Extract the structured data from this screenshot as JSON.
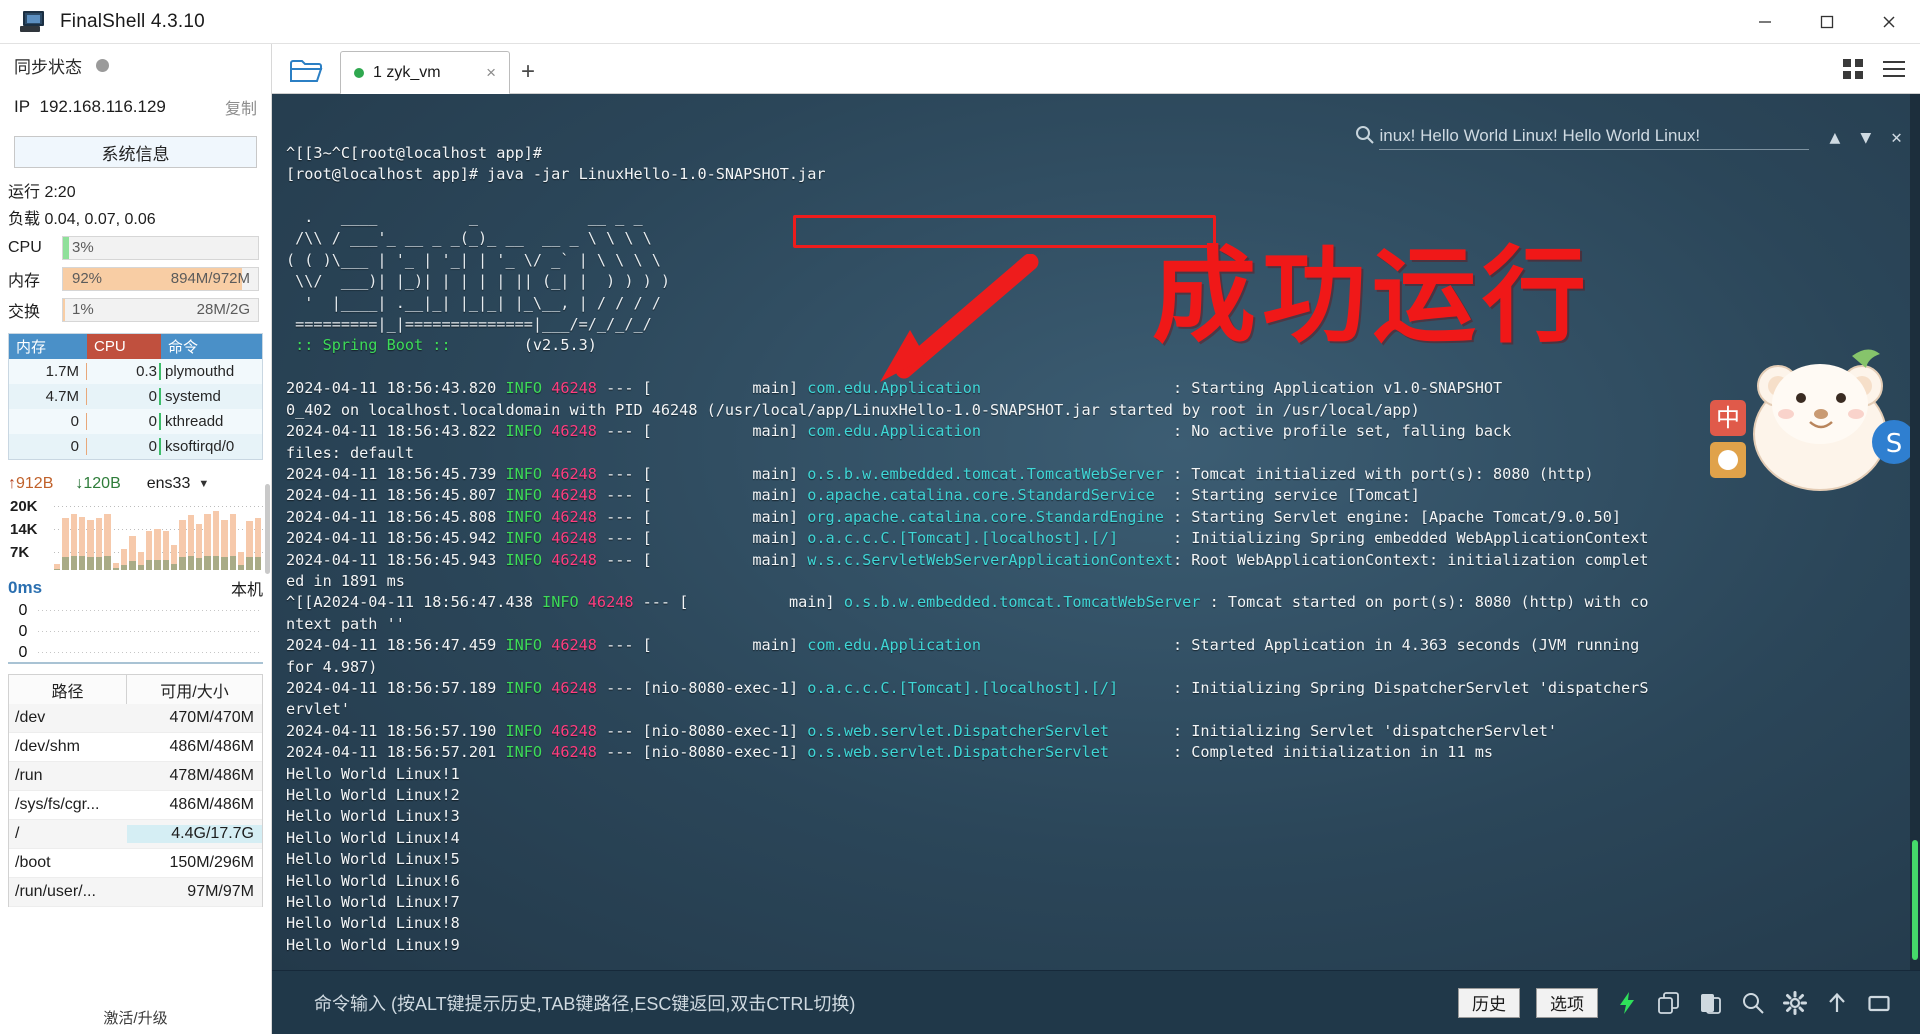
{
  "window": {
    "title": "FinalShell 4.3.10",
    "app_icon": "computer-icon",
    "minimize": "minimize-icon",
    "maximize": "maximize-icon",
    "close": "close-icon"
  },
  "sidebar": {
    "sync_label": "同步状态",
    "ip_label": "IP",
    "ip_value": "192.168.116.129",
    "copy_label": "复制",
    "sysinfo_button": "系统信息",
    "uptime": "运行 2:20",
    "load": "负载 0.04, 0.07, 0.06",
    "meters": [
      {
        "label": "CPU",
        "pct": "3%",
        "value": "",
        "fill": 3,
        "color": "#8fe09a"
      },
      {
        "label": "内存",
        "pct": "92%",
        "value": "894M/972M",
        "fill": 92,
        "color": "#f8cda4"
      },
      {
        "label": "交换",
        "pct": "1%",
        "value": "28M/2G",
        "fill": 1,
        "color": "#f8cda4"
      }
    ],
    "proc_headers": [
      "内存",
      "CPU",
      "命令"
    ],
    "processes": [
      {
        "mem": "1.7M",
        "cpu": "0.3",
        "cmd": "plymouthd"
      },
      {
        "mem": "4.7M",
        "cpu": "0",
        "cmd": "systemd"
      },
      {
        "mem": "0",
        "cpu": "0",
        "cmd": "kthreadd"
      },
      {
        "mem": "0",
        "cpu": "0",
        "cmd": "ksoftirqd/0"
      }
    ],
    "network": {
      "up": "912B",
      "down": "120B",
      "interface": "ens33",
      "y_labels": [
        "20K",
        "14K",
        "7K"
      ],
      "bars": [
        8,
        74,
        80,
        76,
        72,
        74,
        80,
        10,
        30,
        48,
        26,
        56,
        58,
        56,
        36,
        72,
        78,
        66,
        80,
        84,
        72,
        80,
        26,
        70,
        74
      ]
    },
    "ping": {
      "top_label": "0ms",
      "local_label": "本机",
      "values": [
        "0",
        "0",
        "0"
      ]
    },
    "disk_headers": [
      "路径",
      "可用/大小"
    ],
    "disks": [
      {
        "path": "/dev",
        "size": "470M/470M",
        "highlight": false
      },
      {
        "path": "/dev/shm",
        "size": "486M/486M",
        "highlight": false
      },
      {
        "path": "/run",
        "size": "478M/486M",
        "highlight": false
      },
      {
        "path": "/sys/fs/cgr...",
        "size": "486M/486M",
        "highlight": false
      },
      {
        "path": "/",
        "size": "4.4G/17.7G",
        "highlight": true
      },
      {
        "path": "/boot",
        "size": "150M/296M",
        "highlight": false
      },
      {
        "path": "/run/user/...",
        "size": "97M/97M",
        "highlight": false
      }
    ],
    "activate": "激活/升级"
  },
  "tabs": {
    "folder_icon": "folder-open-icon",
    "items": [
      {
        "label": "1 zyk_vm",
        "status": "connected",
        "close": "×"
      }
    ],
    "add": "+",
    "grid_icon": "grid-view-icon",
    "menu_icon": "hamburger-menu-icon"
  },
  "terminal": {
    "search": {
      "icon": "search-icon",
      "value": "inux! Hello World Linux! Hello World Linux!",
      "prev": "▲",
      "next": "▼",
      "close": "✕"
    },
    "annotation": {
      "highlight_label": "java -jar LinuxHello-1.0-SNAPSHOT.jar",
      "arrow": "red-arrow-annotation",
      "success_text": "成功运行",
      "success_color": "#f01818",
      "mascot": "bear-sticker"
    },
    "prompt_lines": [
      "^[[3~^C[root@localhost app]#",
      "[root@localhost app]# java -jar LinuxHello-1.0-SNAPSHOT.jar"
    ],
    "banner": [
      "  .   ____          _            __ _ _",
      " /\\\\ / ___'_ __ _ _(_)_ __  __ _ \\ \\ \\ \\",
      "( ( )\\___ | '_ | '_| | '_ \\/ _` | \\ \\ \\ \\",
      " \\\\/  ___)| |_)| | | | | || (_| |  ) ) ) )",
      "  '  |____| .__|_| |_|_| |_\\__, | / / / /",
      " =========|_|==============|___/=/_/_/_/"
    ],
    "banner_footer_left": " :: Spring Boot :: ",
    "banner_footer_right": "       (v2.5.3)",
    "logs": [
      {
        "ts": "2024-04-11 18:56:43.820",
        "level": "INFO",
        "pid": "46248",
        "thread": "main",
        "logger": "com.edu.Application",
        "msg": ": Starting Application v1.0-SNAPSHOT"
      },
      {
        "cont": "0_402 on localhost.localdomain with PID 46248 (/usr/local/app/LinuxHello-1.0-SNAPSHOT.jar started by root in /usr/local/app)"
      },
      {
        "ts": "2024-04-11 18:56:43.822",
        "level": "INFO",
        "pid": "46248",
        "thread": "main",
        "logger": "com.edu.Application",
        "msg": ": No active profile set, falling back"
      },
      {
        "cont": "files: default"
      },
      {
        "ts": "2024-04-11 18:56:45.739",
        "level": "INFO",
        "pid": "46248",
        "thread": "main",
        "logger": "o.s.b.w.embedded.tomcat.TomcatWebServer",
        "msg": ": Tomcat initialized with port(s): 8080 (http)"
      },
      {
        "ts": "2024-04-11 18:56:45.807",
        "level": "INFO",
        "pid": "46248",
        "thread": "main",
        "logger": "o.apache.catalina.core.StandardService",
        "msg": ": Starting service [Tomcat]"
      },
      {
        "ts": "2024-04-11 18:56:45.808",
        "level": "INFO",
        "pid": "46248",
        "thread": "main",
        "logger": "org.apache.catalina.core.StandardEngine",
        "msg": ": Starting Servlet engine: [Apache Tomcat/9.0.50]"
      },
      {
        "ts": "2024-04-11 18:56:45.942",
        "level": "INFO",
        "pid": "46248",
        "thread": "main",
        "logger": "o.a.c.c.C.[Tomcat].[localhost].[/]",
        "msg": ": Initializing Spring embedded WebApplicationContext"
      },
      {
        "ts": "2024-04-11 18:56:45.943",
        "level": "INFO",
        "pid": "46248",
        "thread": "main",
        "logger": "w.s.c.ServletWebServerApplicationContext",
        "msg": ": Root WebApplicationContext: initialization complet"
      },
      {
        "cont": "ed in 1891 ms"
      },
      {
        "ts": "^[[A2024-04-11 18:56:47.438",
        "level": "INFO",
        "pid": "46248",
        "thread": "main",
        "logger": "o.s.b.w.embedded.tomcat.TomcatWebServer",
        "msg": ": Tomcat started on port(s): 8080 (http) with co"
      },
      {
        "cont": "ntext path ''"
      },
      {
        "ts": "2024-04-11 18:56:47.459",
        "level": "INFO",
        "pid": "46248",
        "thread": "main",
        "logger": "com.edu.Application",
        "msg": ": Started Application in 4.363 seconds (JVM running"
      },
      {
        "cont": "for 4.987)"
      },
      {
        "ts": "2024-04-11 18:56:57.189",
        "level": "INFO",
        "pid": "46248",
        "thread": "nio-8080-exec-1",
        "logger": "o.a.c.c.C.[Tomcat].[localhost].[/]",
        "msg": ": Initializing Spring DispatcherServlet 'dispatcherS"
      },
      {
        "cont": "ervlet'"
      },
      {
        "ts": "2024-04-11 18:56:57.190",
        "level": "INFO",
        "pid": "46248",
        "thread": "nio-8080-exec-1",
        "logger": "o.s.web.servlet.DispatcherServlet",
        "msg": ": Initializing Servlet 'dispatcherServlet'"
      },
      {
        "ts": "2024-04-11 18:56:57.201",
        "level": "INFO",
        "pid": "46248",
        "thread": "nio-8080-exec-1",
        "logger": "o.s.web.servlet.DispatcherServlet",
        "msg": ": Completed initialization in 11 ms"
      }
    ],
    "output_lines": [
      "Hello World Linux!1",
      "Hello World Linux!2",
      "Hello World Linux!3",
      "Hello World Linux!4",
      "Hello World Linux!5",
      "Hello World Linux!6",
      "Hello World Linux!7",
      "Hello World Linux!8",
      "Hello World Linux!9"
    ]
  },
  "cmdbar": {
    "placeholder": "命令输入 (按ALT键提示历史,TAB键路径,ESC键返回,双击CTRL切换)",
    "history_button": "历史",
    "options_button": "选项",
    "icons": [
      "lightning-icon",
      "copy-icon",
      "paste-icon",
      "search-icon",
      "gear-icon",
      "upload-icon",
      "window-icon"
    ]
  }
}
